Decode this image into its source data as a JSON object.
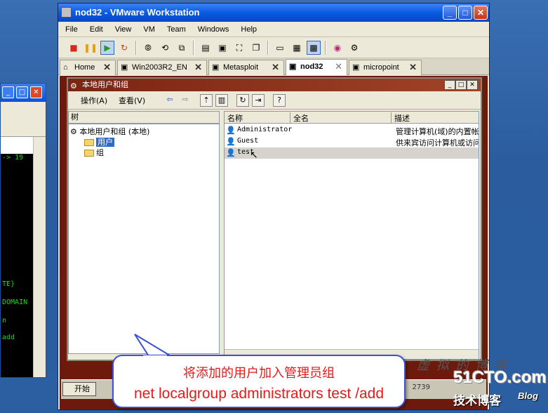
{
  "vmware": {
    "title": "nod32 - VMware Workstation",
    "menu": [
      "File",
      "Edit",
      "View",
      "VM",
      "Team",
      "Windows",
      "Help"
    ],
    "tabs": [
      {
        "label": "Home",
        "active": false
      },
      {
        "label": "Win2003R2_EN",
        "active": false
      },
      {
        "label": "Metasploit",
        "active": false
      },
      {
        "label": "nod32",
        "active": true
      },
      {
        "label": "micropoint",
        "active": false
      }
    ]
  },
  "terminal": {
    "lines": [
      "-> 19",
      "TE}",
      "DOMAIN",
      "n",
      "add"
    ]
  },
  "mmc": {
    "title": "本地用户和组",
    "menu_action": "操作(A)",
    "menu_view": "查看(V)",
    "tree_header": "树",
    "tree_root": "本地用户和组 (本地)",
    "tree_users": "用户",
    "tree_groups": "组",
    "columns": [
      "名称",
      "全名",
      "描述"
    ],
    "rows": [
      {
        "name": "Administrator",
        "fullname": "",
        "desc": "管理计算机(域)的内置帐"
      },
      {
        "name": "Guest",
        "fullname": "",
        "desc": "供来宾访问计算机或访问"
      },
      {
        "name": "test",
        "fullname": "",
        "desc": ""
      }
    ]
  },
  "vm_taskbar": {
    "start": "开始",
    "clock": "2739"
  },
  "callout": {
    "line1": "将添加的用户加入管理员组",
    "line2": "net localgroup administrators test /add"
  },
  "watermark": {
    "chinese": "虚 拟 的 博 客",
    "site": "51CTO.com",
    "sub": "技术博客",
    "blog": "Blog"
  },
  "colors": {
    "callout_text": "#e51a1a",
    "callout_border": "#3b4fd8",
    "xp_title": "#0a5be0",
    "vm_bg": "#6d1a0c"
  }
}
